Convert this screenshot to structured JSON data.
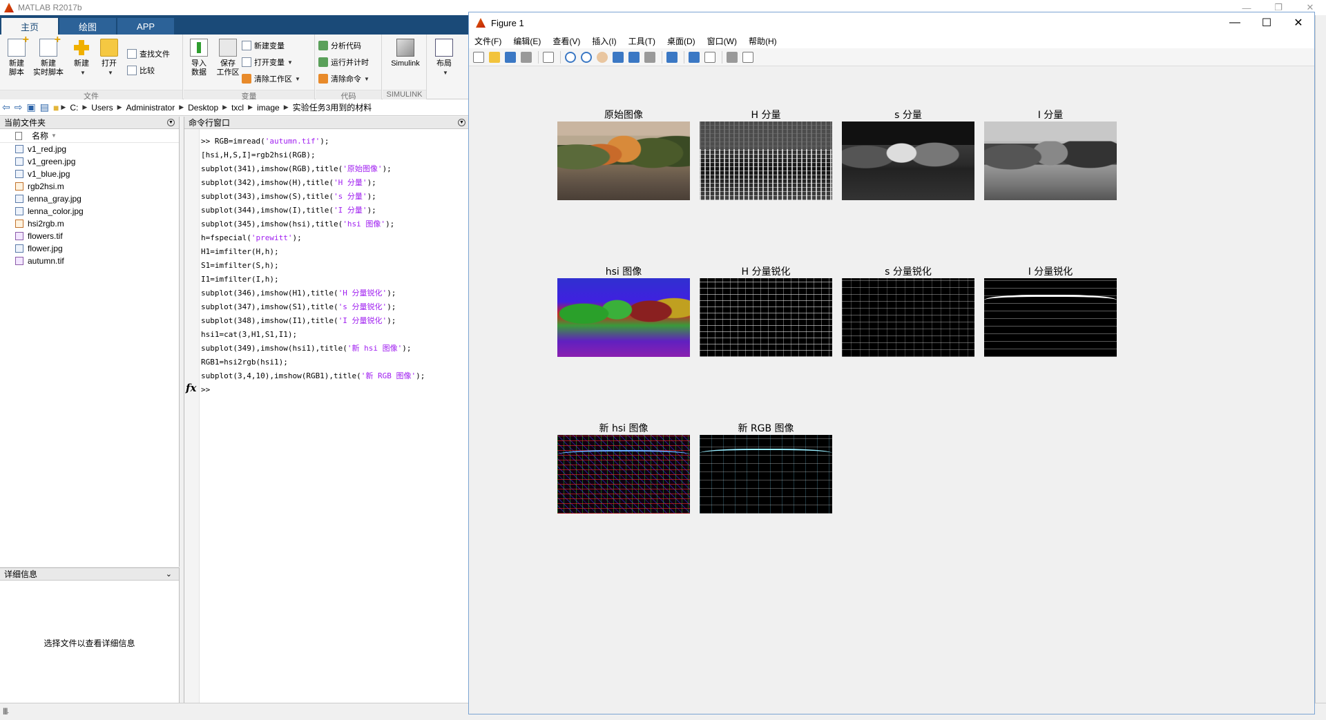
{
  "app": {
    "title": "MATLAB R2017b",
    "tabs": [
      "主页",
      "绘图",
      "APP"
    ]
  },
  "ribbon": {
    "groups": {
      "file": "文件",
      "variable": "变量",
      "code": "代码",
      "simulink": "SIMULINK"
    },
    "new_script": "新建\n脚本",
    "new_live_script": "新建\n实时脚本",
    "new": "新建",
    "open": "打开",
    "find_files": "查找文件",
    "compare": "比较",
    "import_data": "导入\n数据",
    "save_workspace": "保存\n工作区",
    "new_variable": "新建变量",
    "open_variable": "打开变量",
    "clear_workspace": "清除工作区",
    "analyze_code": "分析代码",
    "run_and_time": "运行并计时",
    "clear_commands": "清除命令",
    "simulink": "Simulink",
    "layout": "布局"
  },
  "address": {
    "path": [
      "C:",
      "Users",
      "Administrator",
      "Desktop",
      "txcl",
      "image",
      "实验任务3用到的材料"
    ]
  },
  "current_folder": {
    "title": "当前文件夹",
    "column_name": "名称",
    "files": [
      {
        "name": "v1_red.jpg",
        "type": "img"
      },
      {
        "name": "v1_green.jpg",
        "type": "img"
      },
      {
        "name": "v1_blue.jpg",
        "type": "img"
      },
      {
        "name": "rgb2hsi.m",
        "type": "m"
      },
      {
        "name": "lenna_gray.jpg",
        "type": "img"
      },
      {
        "name": "lenna_color.jpg",
        "type": "img"
      },
      {
        "name": "hsi2rgb.m",
        "type": "m"
      },
      {
        "name": "flowers.tif",
        "type": "tif"
      },
      {
        "name": "flower.jpg",
        "type": "img"
      },
      {
        "name": "autumn.tif",
        "type": "tif"
      }
    ]
  },
  "details": {
    "title": "详细信息",
    "empty_text": "选择文件以查看详细信息"
  },
  "command_window": {
    "title": "命令行窗口",
    "lines": [
      [
        ">> RGB=imread(",
        "'autumn.tif'",
        ");"
      ],
      [
        "[hsi,H,S,I]=rgb2hsi(RGB);"
      ],
      [
        "subplot(341),imshow(RGB),title(",
        "'原始图像'",
        ");"
      ],
      [
        "subplot(342),imshow(H),title(",
        "'H 分量'",
        ");"
      ],
      [
        "subplot(343),imshow(S),title(",
        "'s 分量'",
        ");"
      ],
      [
        "subplot(344),imshow(I),title(",
        "'I 分量'",
        ");"
      ],
      [
        "subplot(345),imshow(hsi),title(",
        "'hsi 图像'",
        ");"
      ],
      [
        "h=fspecial(",
        "'prewitt'",
        ");"
      ],
      [
        "H1=imfilter(H,h);"
      ],
      [
        "S1=imfilter(S,h);"
      ],
      [
        "I1=imfilter(I,h);"
      ],
      [
        "subplot(346),imshow(H1),title(",
        "'H 分量锐化'",
        ");"
      ],
      [
        "subplot(347),imshow(S1),title(",
        "'s 分量锐化'",
        ");"
      ],
      [
        "subplot(348),imshow(I1),title(",
        "'I 分量锐化'",
        ");"
      ],
      [
        "hsi1=cat(3,H1,S1,I1);"
      ],
      [
        "subplot(349),imshow(hsi1),title(",
        "'新 hsi 图像'",
        ");"
      ],
      [
        "RGB1=hsi2rgb(hsi1);"
      ],
      [
        "subplot(3,4,10),imshow(RGB1),title(",
        "'新 RGB 图像'",
        ");"
      ]
    ],
    "prompt": ">>",
    "fx": "fx"
  },
  "figure": {
    "title": "Figure 1",
    "menu": [
      "文件(F)",
      "编辑(E)",
      "查看(V)",
      "插入(I)",
      "工具(T)",
      "桌面(D)",
      "窗口(W)",
      "帮助(H)"
    ],
    "subplots": [
      {
        "title": "原始图像",
        "kind": "orig"
      },
      {
        "title": "H 分量",
        "kind": "hcomp"
      },
      {
        "title": "s 分量",
        "kind": "scomp"
      },
      {
        "title": "I 分量",
        "kind": "icomp"
      },
      {
        "title": "hsi 图像",
        "kind": "hsi"
      },
      {
        "title": "H 分量锐化",
        "kind": "edge"
      },
      {
        "title": "s 分量锐化",
        "kind": "edge e-s"
      },
      {
        "title": "I 分量锐化",
        "kind": "edge e-i"
      },
      {
        "title": "新 hsi 图像",
        "kind": "newhsi"
      },
      {
        "title": "新 RGB 图像",
        "kind": "newrgb"
      }
    ]
  }
}
